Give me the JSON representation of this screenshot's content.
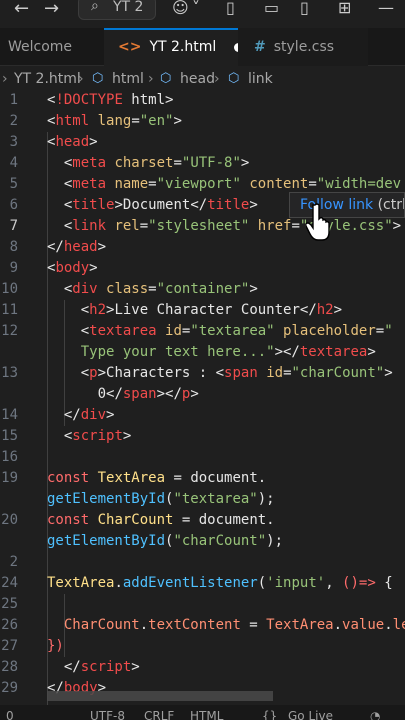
{
  "titlebar": {
    "back_icon": "arrow-left-icon",
    "forward_icon": "arrow-right-icon",
    "search_label": "YT 2",
    "copilot_icon": "copilot-icon",
    "layout_icons": [
      "panel-left-icon",
      "panel-bottom-icon",
      "panel-right-icon",
      "layout-icon"
    ]
  },
  "tabs": [
    {
      "label": "Welcome",
      "icon": "vscode-icon",
      "active": false
    },
    {
      "label": "YT 2.html",
      "icon_text": "<>",
      "active": true,
      "dirty": true
    },
    {
      "label": "style.css",
      "icon_text": "#",
      "active": false
    }
  ],
  "breadcrumb": [
    "YT 2.html",
    "html",
    "head",
    "link"
  ],
  "hover": {
    "link_text": "Follow link",
    "hint": " (ctrl"
  },
  "editor": {
    "current_line": 7,
    "lines": [
      {
        "n": "1",
        "tokens": [
          [
            "br",
            "<"
          ],
          [
            "kwbang",
            "!DOCTYPE"
          ],
          [
            "plain",
            " html"
          ],
          [
            "br",
            ">"
          ]
        ]
      },
      {
        "n": "2",
        "tokens": [
          [
            "br",
            "<"
          ],
          [
            "tag",
            "html"
          ],
          [
            "attr",
            " lang"
          ],
          [
            "br",
            "="
          ],
          [
            "str",
            "\"en\""
          ],
          [
            "br",
            ">"
          ]
        ]
      },
      {
        "n": "3",
        "tokens": [
          [
            "br",
            "<"
          ],
          [
            "tag",
            "head"
          ],
          [
            "br",
            ">"
          ]
        ]
      },
      {
        "n": "4",
        "tokens": [
          [
            "plain",
            "  "
          ],
          [
            "br",
            "<"
          ],
          [
            "tag",
            "meta"
          ],
          [
            "attr",
            " charset"
          ],
          [
            "br",
            "="
          ],
          [
            "str",
            "\"UTF-8\""
          ],
          [
            "br",
            ">"
          ]
        ]
      },
      {
        "n": "5",
        "tokens": [
          [
            "plain",
            "  "
          ],
          [
            "br",
            "<"
          ],
          [
            "tag",
            "meta"
          ],
          [
            "attr",
            " name"
          ],
          [
            "br",
            "="
          ],
          [
            "str",
            "\"viewport\""
          ],
          [
            "attr",
            " content"
          ],
          [
            "br",
            "="
          ],
          [
            "str",
            "\"width=dev"
          ]
        ]
      },
      {
        "n": "6",
        "tokens": [
          [
            "plain",
            "  "
          ],
          [
            "br",
            "<"
          ],
          [
            "tag",
            "title"
          ],
          [
            "br",
            ">"
          ],
          [
            "plain",
            "Document"
          ],
          [
            "br",
            "</"
          ],
          [
            "tag",
            "title"
          ],
          [
            "br",
            ">"
          ]
        ]
      },
      {
        "n": "7",
        "tokens": [
          [
            "plain",
            "  "
          ],
          [
            "br",
            "<"
          ],
          [
            "tag",
            "link"
          ],
          [
            "attr",
            " rel"
          ],
          [
            "br",
            "="
          ],
          [
            "str",
            "\"stylesheet\""
          ],
          [
            "attr",
            " href"
          ],
          [
            "br",
            "="
          ],
          [
            "str",
            "\"style.css\""
          ],
          [
            "br",
            ">"
          ]
        ]
      },
      {
        "n": "8",
        "tokens": [
          [
            "br",
            "</"
          ],
          [
            "tag",
            "head"
          ],
          [
            "br",
            ">"
          ]
        ]
      },
      {
        "n": "9",
        "tokens": [
          [
            "br",
            "<"
          ],
          [
            "tag",
            "body"
          ],
          [
            "br",
            ">"
          ]
        ]
      },
      {
        "n": "10",
        "tokens": [
          [
            "plain",
            "  "
          ],
          [
            "br",
            "<"
          ],
          [
            "tag",
            "div"
          ],
          [
            "attr",
            " class"
          ],
          [
            "br",
            "="
          ],
          [
            "str",
            "\"container\""
          ],
          [
            "br",
            ">"
          ]
        ]
      },
      {
        "n": "11",
        "tokens": [
          [
            "plain",
            "    "
          ],
          [
            "br",
            "<"
          ],
          [
            "tag",
            "h2"
          ],
          [
            "br",
            ">"
          ],
          [
            "plain",
            "Live Character Counter"
          ],
          [
            "br",
            "</"
          ],
          [
            "tag",
            "h2"
          ],
          [
            "br",
            ">"
          ]
        ]
      },
      {
        "n": "12",
        "tokens": [
          [
            "plain",
            "    "
          ],
          [
            "br",
            "<"
          ],
          [
            "tag",
            "textarea"
          ],
          [
            "attr",
            " id"
          ],
          [
            "br",
            "="
          ],
          [
            "str",
            "\"textarea\""
          ],
          [
            "attr",
            " placeholder"
          ],
          [
            "br",
            "="
          ],
          [
            "str",
            "\""
          ]
        ]
      },
      {
        "n": "",
        "tokens": [
          [
            "str",
            "    Type your text here...\""
          ],
          [
            "br",
            "></"
          ],
          [
            "tag",
            "textarea"
          ],
          [
            "br",
            ">"
          ]
        ]
      },
      {
        "n": "13",
        "tokens": [
          [
            "plain",
            "    "
          ],
          [
            "br",
            "<"
          ],
          [
            "tag",
            "p"
          ],
          [
            "br",
            ">"
          ],
          [
            "plain",
            "Characters : "
          ],
          [
            "br",
            "<"
          ],
          [
            "tag",
            "span"
          ],
          [
            "attr",
            " id"
          ],
          [
            "br",
            "="
          ],
          [
            "str",
            "\"charCount\""
          ],
          [
            "br",
            ">"
          ]
        ]
      },
      {
        "n": "",
        "tokens": [
          [
            "plain",
            "      0"
          ],
          [
            "br",
            "</"
          ],
          [
            "tag",
            "span"
          ],
          [
            "br",
            "></"
          ],
          [
            "tag",
            "p"
          ],
          [
            "br",
            ">"
          ]
        ]
      },
      {
        "n": "14",
        "tokens": [
          [
            "plain",
            "  "
          ],
          [
            "br",
            "</"
          ],
          [
            "tag",
            "div"
          ],
          [
            "br",
            ">"
          ]
        ]
      },
      {
        "n": "15",
        "tokens": [
          [
            "plain",
            "  "
          ],
          [
            "br",
            "<"
          ],
          [
            "tag",
            "script"
          ],
          [
            "br",
            ">"
          ]
        ]
      },
      {
        "n": "16",
        "tokens": []
      },
      {
        "n": "19",
        "tokens": [
          [
            "kw",
            "const"
          ],
          [
            "var",
            " TextArea"
          ],
          [
            "plain",
            " = "
          ],
          [
            "plain",
            "document."
          ]
        ]
      },
      {
        "n": "",
        "tokens": [
          [
            "fn",
            "getElementById"
          ],
          [
            "plain",
            "("
          ],
          [
            "str",
            "\"textarea\""
          ],
          [
            "plain",
            ");"
          ]
        ]
      },
      {
        "n": "20",
        "tokens": [
          [
            "kw",
            "const"
          ],
          [
            "var",
            " CharCount"
          ],
          [
            "plain",
            " = "
          ],
          [
            "plain",
            "document."
          ]
        ]
      },
      {
        "n": "",
        "tokens": [
          [
            "fn",
            "getElementById"
          ],
          [
            "plain",
            "("
          ],
          [
            "str",
            "\"charCount\""
          ],
          [
            "plain",
            ");"
          ]
        ]
      },
      {
        "n": "2",
        "tokens": []
      },
      {
        "n": "24",
        "tokens": [
          [
            "var",
            "TextArea"
          ],
          [
            "plain",
            "."
          ],
          [
            "fn",
            "addEventListener"
          ],
          [
            "plain",
            "("
          ],
          [
            "str",
            "'input'"
          ],
          [
            "plain",
            ", "
          ],
          [
            "kw",
            "()"
          ],
          [
            "kw",
            "=>"
          ],
          [
            "plain",
            " {"
          ]
        ]
      },
      {
        "n": "25",
        "tokens": []
      },
      {
        "n": "26",
        "tokens": [
          [
            "plain",
            "  "
          ],
          [
            "prop",
            "CharCount"
          ],
          [
            "plain",
            "."
          ],
          [
            "prop",
            "textContent"
          ],
          [
            "plain",
            " = "
          ],
          [
            "prop",
            "TextArea"
          ],
          [
            "plain",
            "."
          ],
          [
            "prop",
            "value"
          ],
          [
            "plain",
            "."
          ],
          [
            "prop",
            "le"
          ]
        ]
      },
      {
        "n": "27",
        "tokens": [
          [
            "kw",
            "})"
          ]
        ]
      },
      {
        "n": "28",
        "tokens": [
          [
            "plain",
            "  "
          ],
          [
            "br",
            "</"
          ],
          [
            "tag",
            "script"
          ],
          [
            "br",
            ">"
          ]
        ]
      },
      {
        "n": "29",
        "tokens": [
          [
            "br",
            "</"
          ],
          [
            "tag",
            "body"
          ],
          [
            "br",
            ">"
          ]
        ]
      }
    ]
  },
  "statusbar": [
    "0",
    "UTF-8",
    "CRLF",
    "HTML",
    "Go Live"
  ]
}
